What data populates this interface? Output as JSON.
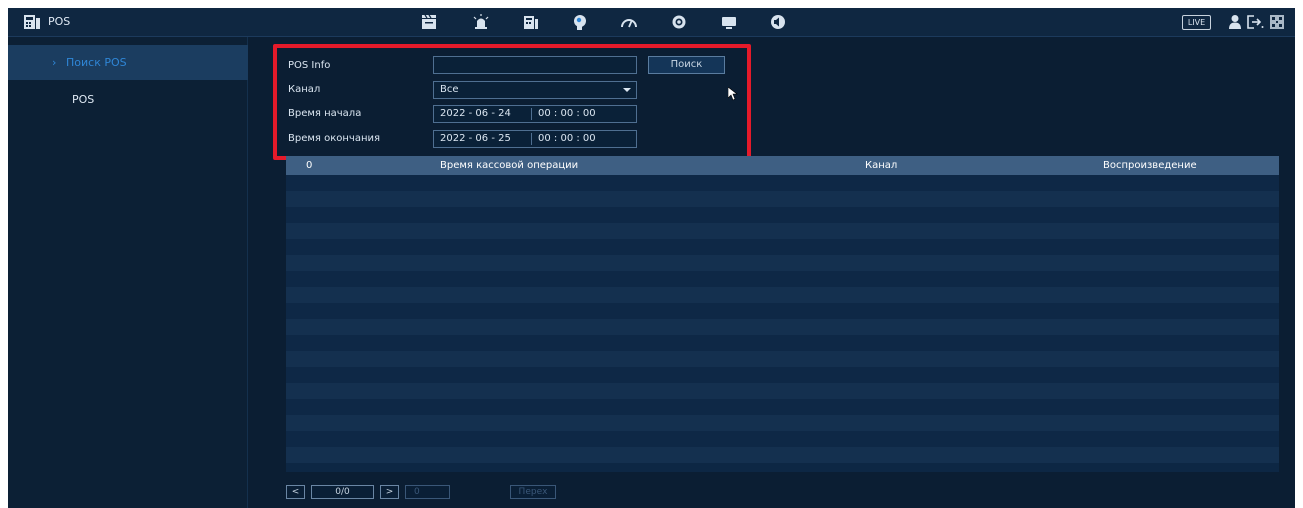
{
  "topbar": {
    "title": "POS",
    "icons": [
      "record-icon",
      "alarm-icon",
      "storage-icon",
      "ai-icon",
      "dashboard-icon",
      "camera-icon",
      "display-icon",
      "audio-icon"
    ],
    "live_label": "LIVE"
  },
  "sidebar": {
    "items": [
      {
        "label": "Поиск POS",
        "active": true
      },
      {
        "label": "POS",
        "active": false
      }
    ]
  },
  "form": {
    "posinfo_label": "POS Info",
    "posinfo_value": "",
    "search_button": "Поиск",
    "channel_label": "Канал",
    "channel_value": "Все",
    "start_label": "Время начала",
    "start_date": "2022 - 06 - 24",
    "start_time": "00 : 00 : 00",
    "end_label": "Время окончания",
    "end_date": "2022 - 06 - 25",
    "end_time": "00 : 00 : 00"
  },
  "table": {
    "columns": [
      "0",
      "Время кассовой операции",
      "Канал",
      "Воспроизведение"
    ],
    "rows": []
  },
  "pagination": {
    "prev": "<",
    "page": "0/0",
    "next": ">",
    "goto_value": "0",
    "goto_button": "Перех"
  },
  "colors": {
    "background": "#0b1e33",
    "highlight": "#e51a2a",
    "accent": "#2f86d6",
    "table_header": "#3e5f83"
  }
}
